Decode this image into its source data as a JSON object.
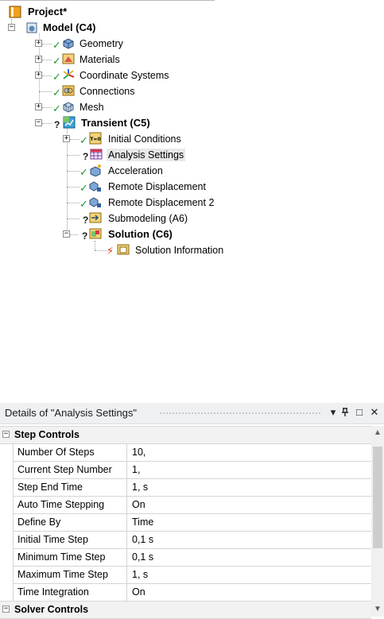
{
  "tree": {
    "project": "Project*",
    "model": "Model (C4)",
    "geometry": "Geometry",
    "materials": "Materials",
    "coordinate_systems": "Coordinate Systems",
    "connections": "Connections",
    "mesh": "Mesh",
    "transient": "Transient (C5)",
    "initial_conditions": "Initial Conditions",
    "analysis_settings": "Analysis Settings",
    "acceleration": "Acceleration",
    "remote_displacement": "Remote Displacement",
    "remote_displacement_2": "Remote Displacement 2",
    "submodeling": "Submodeling (A6)",
    "solution": "Solution (C6)",
    "solution_information": "Solution Information",
    "expand_plus": "+",
    "collapse_minus": "−",
    "check_glyph": "✓",
    "question_glyph": "?",
    "bolt_glyph": "⚡",
    "initial_icon_text": "T=0"
  },
  "details": {
    "title": "Details of \"Analysis Settings\"",
    "buttons": {
      "dropdown": "▾",
      "pin": "Q",
      "maximize": "□",
      "close": "✕"
    },
    "sections": [
      {
        "label": "Step Controls",
        "rows": [
          {
            "key": "Number Of Steps",
            "value": "10,"
          },
          {
            "key": "Current Step Number",
            "value": "1,"
          },
          {
            "key": "Step End Time",
            "value": "1, s"
          },
          {
            "key": "Auto Time Stepping",
            "value": "On"
          },
          {
            "key": "Define By",
            "value": "Time"
          },
          {
            "key": "Initial Time Step",
            "value": "0,1 s"
          },
          {
            "key": "Minimum Time Step",
            "value": "0,1 s"
          },
          {
            "key": "Maximum Time Step",
            "value": "1, s"
          },
          {
            "key": "Time Integration",
            "value": "On"
          }
        ]
      },
      {
        "label": "Solver Controls",
        "rows": []
      }
    ],
    "scroll_up": "▲",
    "scroll_down": "▼"
  },
  "colors": {
    "check": "#1f9a2e",
    "bolt": "#e03a10",
    "selected_bg": "#e8e8e8",
    "header_bg": "#eef0f2"
  }
}
